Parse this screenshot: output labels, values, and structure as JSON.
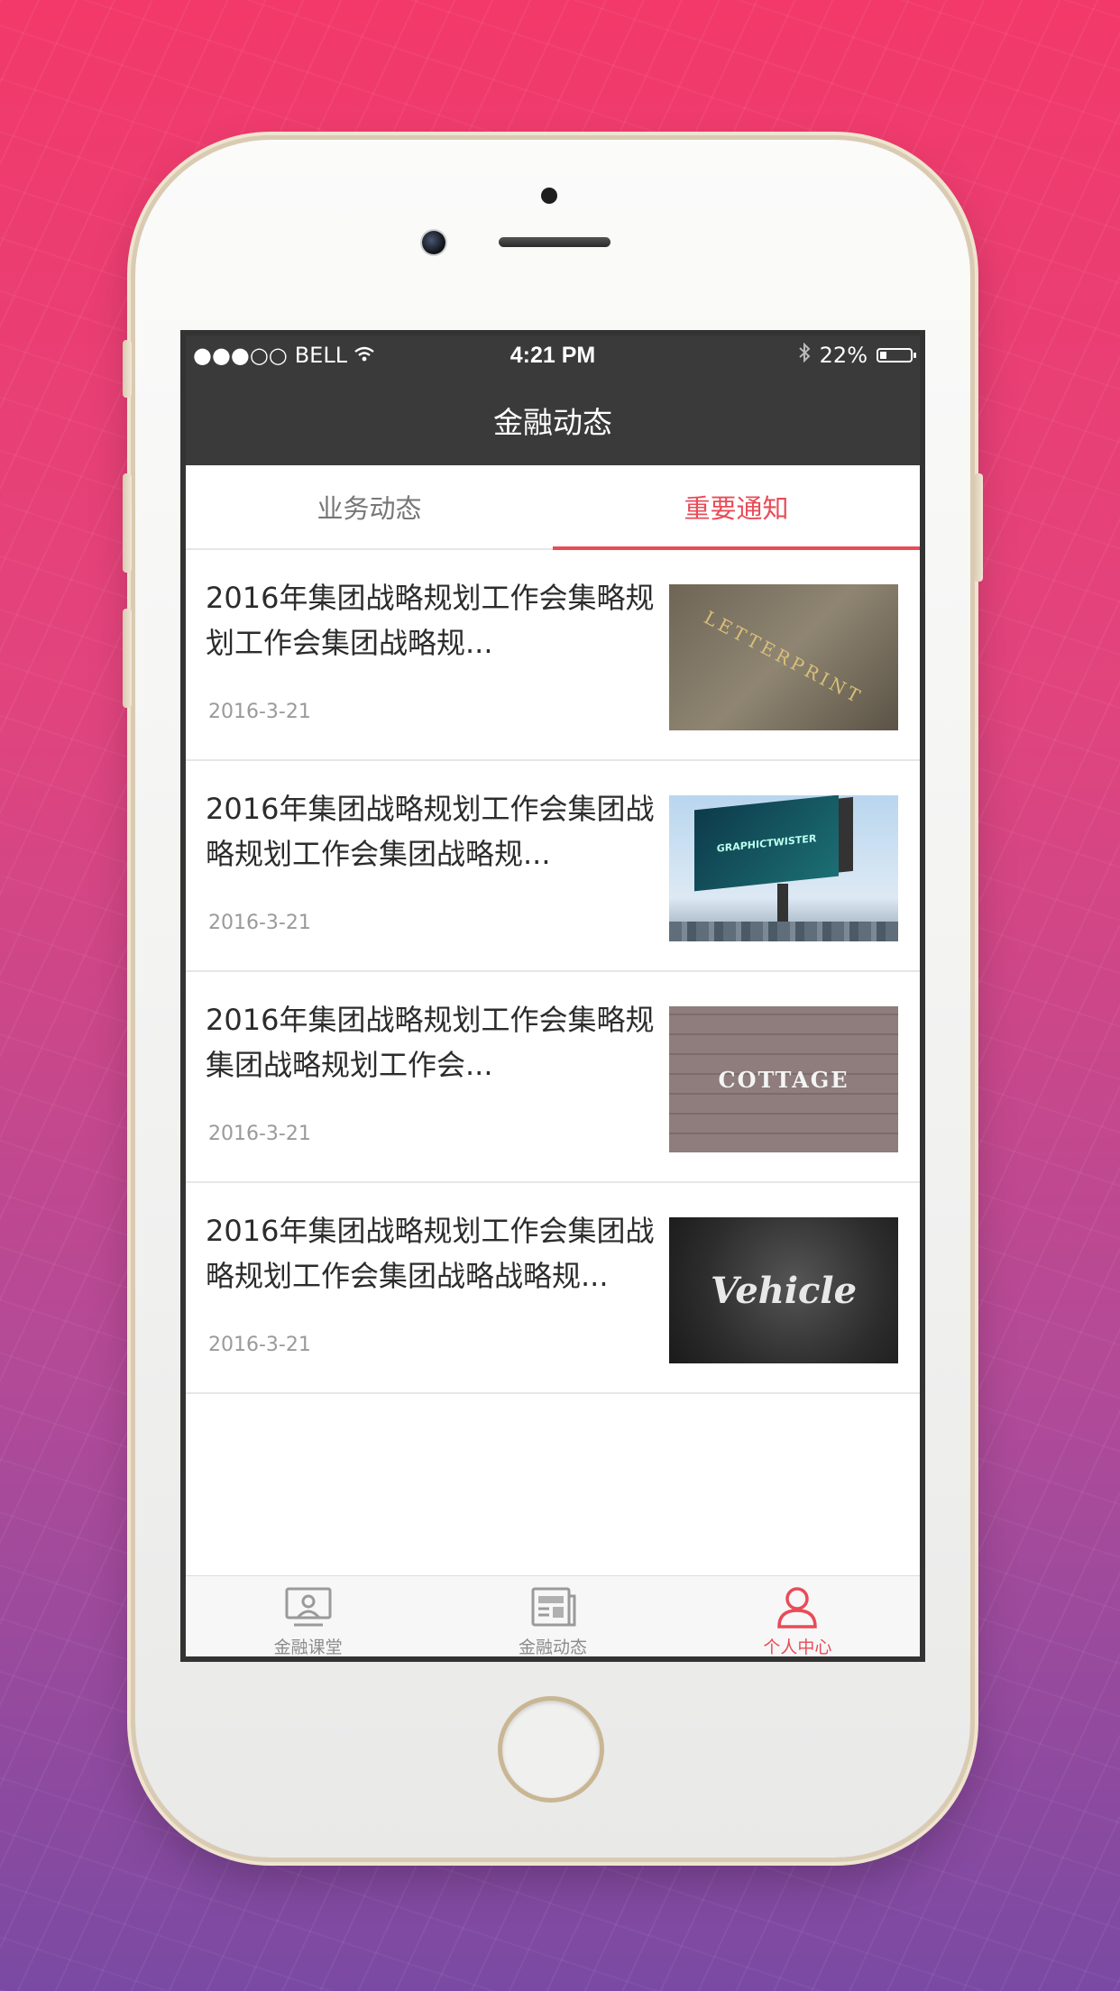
{
  "status_bar": {
    "signal": "●●●○○",
    "carrier": "BELL",
    "time": "4:21 PM",
    "battery_percent": "22%",
    "battery_level": 0.22
  },
  "nav": {
    "title": "金融动态"
  },
  "tabs": [
    {
      "label": "业务动态",
      "active": false
    },
    {
      "label": "重要通知",
      "active": true
    }
  ],
  "news": [
    {
      "title": "2016年集团战略规划工作会集略规划工作会集团战略规...",
      "date": "2016-3-21",
      "thumb_text": "LETTERPRINT"
    },
    {
      "title": "2016年集团战略规划工作会集团战略规划工作会集团战略规...",
      "date": "2016-3-21",
      "thumb_text": "GRAPHICTWISTER"
    },
    {
      "title": "2016年集团战略规划工作会集略规集团战略规划工作会...",
      "date": "2016-3-21",
      "thumb_text": "COTTAGE"
    },
    {
      "title": "2016年集团战略规划工作会集团战略规划工作会集团战略战略规...",
      "date": "2016-3-21",
      "thumb_text": "Vehicle"
    }
  ],
  "tabbar": [
    {
      "label": "金融课堂",
      "icon": "classroom-icon",
      "active": false
    },
    {
      "label": "金融动态",
      "icon": "news-icon",
      "active": false
    },
    {
      "label": "个人中心",
      "icon": "user-icon",
      "active": true
    }
  ],
  "colors": {
    "accent": "#e94b58",
    "header_bg": "#3a3a3a"
  }
}
